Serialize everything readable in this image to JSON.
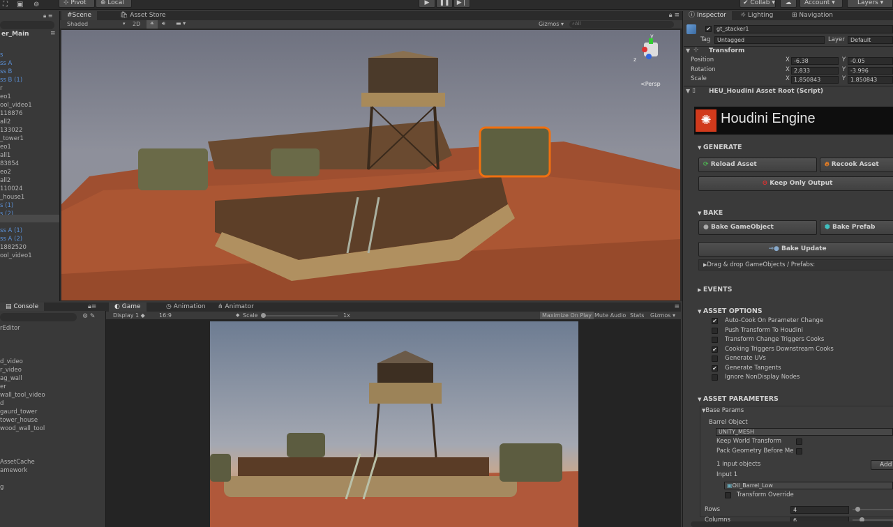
{
  "toolbar": {
    "pivot": "Pivot",
    "local": "Local",
    "collab": "Collab",
    "account": "Account",
    "layers": "Layers"
  },
  "hierarchy": {
    "title": "er_Main",
    "items": [
      {
        "label": "",
        "blue": false
      },
      {
        "label": "s",
        "blue": true
      },
      {
        "label": "ss A",
        "blue": true
      },
      {
        "label": "ss B",
        "blue": true
      },
      {
        "label": "ss B (1)",
        "blue": true
      },
      {
        "label": "r",
        "blue": false
      },
      {
        "label": "eo1",
        "blue": false
      },
      {
        "label": "ool_video1",
        "blue": false
      },
      {
        "label": "118876",
        "blue": false
      },
      {
        "label": "all2",
        "blue": false
      },
      {
        "label": "133022",
        "blue": false
      },
      {
        "label": "_tower1",
        "blue": false
      },
      {
        "label": "eo1",
        "blue": false
      },
      {
        "label": "all1",
        "blue": false
      },
      {
        "label": "83854",
        "blue": false
      },
      {
        "label": "eo2",
        "blue": false
      },
      {
        "label": "all2",
        "blue": false
      },
      {
        "label": "110024",
        "blue": false
      },
      {
        "label": "_house1",
        "blue": false
      },
      {
        "label": "s (1)",
        "blue": true
      },
      {
        "label": "s (2)",
        "blue": true
      },
      {
        "label": "",
        "blue": false
      },
      {
        "label": "ss A (1)",
        "blue": true
      },
      {
        "label": "ss A (2)",
        "blue": true
      },
      {
        "label": "1882520",
        "blue": false
      },
      {
        "label": "ool_video1",
        "blue": false
      }
    ]
  },
  "scene": {
    "tab": "Scene",
    "asset_store_tab": "Asset Store",
    "shaded": "Shaded",
    "mode2d": "2D",
    "gizmos": "Gizmos",
    "search_placeholder": "All",
    "persp": "Persp"
  },
  "console": {
    "tab": "Console",
    "items": [
      "rEditor",
      "",
      "",
      "",
      "d_video",
      "r_video",
      "ag_wall",
      "er",
      "wall_tool_video",
      "d",
      "gaurd_tower",
      "tower_house",
      "wood_wall_tool",
      "",
      "",
      "",
      "AssetCache",
      "amework",
      "",
      "g"
    ]
  },
  "game": {
    "tab": "Game",
    "animation_tab": "Animation",
    "animator_tab": "Animator",
    "display": "Display 1",
    "aspect": "16:9",
    "scale_label": "Scale",
    "scale_value": "1x",
    "maximize": "Maximize On Play",
    "mute": "Mute Audio",
    "stats": "Stats",
    "gizmos": "Gizmos"
  },
  "inspector": {
    "tab": "Inspector",
    "lighting_tab": "Lighting",
    "navigation_tab": "Navigation",
    "object_name": "gt_stacker1",
    "tag_label": "Tag",
    "tag_value": "Untagged",
    "layer_label": "Layer",
    "layer_value": "Default",
    "transform": {
      "title": "Transform",
      "rows": [
        {
          "label": "Position",
          "x": "-6.38",
          "y": "-0.05"
        },
        {
          "label": "Rotation",
          "x": "2.833",
          "y": "-3.996"
        },
        {
          "label": "Scale",
          "x": "1.850843",
          "y": "1.850843"
        }
      ]
    },
    "script_title": "HEU_Houdini Asset Root (Script)",
    "banner": "Houdini Engine",
    "generate": {
      "title": "GENERATE",
      "reload": "Reload Asset",
      "recook": "Recook Asset",
      "keep": "Keep Only Output"
    },
    "bake": {
      "title": "BAKE",
      "bake_go": "Bake GameObject",
      "bake_prefab": "Bake Prefab",
      "bake_update": "Bake Update",
      "drag": "Drag & drop GameObjects / Prefabs:"
    },
    "events": "EVENTS",
    "asset_options": {
      "title": "ASSET OPTIONS",
      "items": [
        {
          "label": "Auto-Cook On Parameter Change",
          "checked": "✔"
        },
        {
          "label": "Push Transform To Houdini",
          "checked": ""
        },
        {
          "label": "Transform Change Triggers Cooks",
          "checked": ""
        },
        {
          "label": "Cooking Triggers Downstream Cooks",
          "checked": "✔"
        },
        {
          "label": "Generate UVs",
          "checked": ""
        },
        {
          "label": "Generate Tangents",
          "checked": "✔"
        },
        {
          "label": "Ignore NonDisplay Nodes",
          "checked": ""
        }
      ]
    },
    "asset_params": {
      "title": "ASSET PARAMETERS",
      "base": "Base Params",
      "barrel": "Barrel Object",
      "unity_mesh": "UNITY_MESH",
      "keep_world": "Keep World Transform",
      "pack_geo": "Pack Geometry Before Me",
      "inputs": "1 input objects",
      "add": "Add",
      "input1": "Input 1",
      "barrel_asset": "Oil_Barrel_Low",
      "transform_override": "Transform Override",
      "rows_label": "Rows",
      "rows_value": "4",
      "columns_label": "Columns",
      "columns_value": "6"
    }
  }
}
